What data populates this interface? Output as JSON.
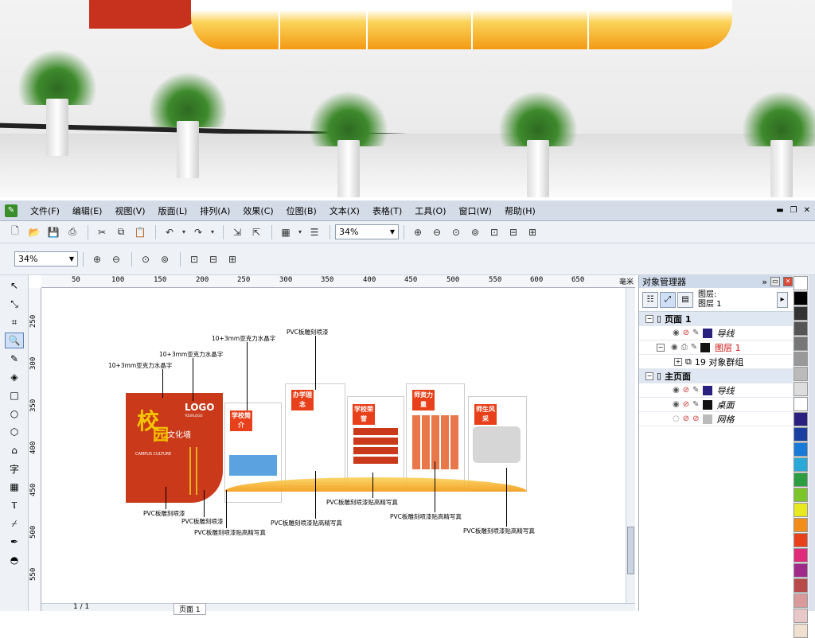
{
  "menu": {
    "items": [
      "文件(F)",
      "编辑(E)",
      "视图(V)",
      "版面(L)",
      "排列(A)",
      "效果(C)",
      "位图(B)",
      "文本(X)",
      "表格(T)",
      "工具(O)",
      "窗口(W)",
      "帮助(H)"
    ]
  },
  "toolbar": {
    "zoom_value": "34%",
    "zoom_value2": "34%"
  },
  "ruler": {
    "h_ticks": [
      "50",
      "100",
      "150",
      "200",
      "250",
      "300",
      "350",
      "400",
      "450",
      "500",
      "550",
      "600",
      "650",
      "毫米"
    ],
    "v_ticks": [
      "250",
      "300",
      "350",
      "400",
      "450",
      "500",
      "550"
    ]
  },
  "canvas": {
    "labels": {
      "l1": "10+3mm亚克力水晶字",
      "l2": "10+3mm亚克力水晶字",
      "l3": "10+3mm亚克力水晶字",
      "l4": "PVC板雕刻喷漆",
      "b1": "PVC板雕刻喷漆",
      "b2": "PVC板雕刻喷漆",
      "b3": "PVC板雕刻喷漆贴高精写真",
      "b4": "PVC板雕刻喷漆贴高精写真",
      "b5": "PVC板雕刻喷漆贴高精写真",
      "b6": "PVC板雕刻喷漆贴高精写真",
      "b7": "PVC板雕刻喷漆贴高精写真"
    },
    "panel_titles": [
      "学校简介",
      "办学理念",
      "学校荣誉",
      "师资力量",
      "师生风采"
    ],
    "logo": "LOGO",
    "logo_sub": "YOURLOGO",
    "main_char1": "校",
    "main_char2": "园",
    "main_sub": "文化墙",
    "main_en": "CAMPUS CULTURE"
  },
  "pagebar": {
    "page_tab": "页面 1",
    "count": "1 / 1"
  },
  "object_manager": {
    "title": "对象管理器",
    "layer_label": "图层:",
    "layer_value": "图层 1",
    "tree": [
      {
        "type": "hdr",
        "label": "页面 1"
      },
      {
        "type": "item",
        "label": "导线",
        "color": "#2a2080"
      },
      {
        "type": "item",
        "label": "图层 1",
        "color": "#111111",
        "red": true
      },
      {
        "type": "sub",
        "label": "19 对象群组"
      },
      {
        "type": "hdr",
        "label": "主页面"
      },
      {
        "type": "item",
        "label": "导线",
        "color": "#2a2080"
      },
      {
        "type": "item",
        "label": "桌面",
        "color": "#111111"
      },
      {
        "type": "item",
        "label": "网格",
        "color": "#bbbbbb"
      }
    ]
  },
  "palette": {
    "colors": [
      "#ffffff",
      "#000000",
      "#333333",
      "#555555",
      "#777777",
      "#999999",
      "#bbbbbb",
      "#dddddd",
      "#ffffff",
      "#2a2080",
      "#1a3fa0",
      "#1a7ad8",
      "#2aa9d8",
      "#2c9d40",
      "#7cc62c",
      "#e8e820",
      "#f28c1a",
      "#e8401a",
      "#e02a7a",
      "#a02a8a",
      "#b84a4a",
      "#d89a9a",
      "#e8c8c8",
      "#f0e0d0"
    ]
  }
}
